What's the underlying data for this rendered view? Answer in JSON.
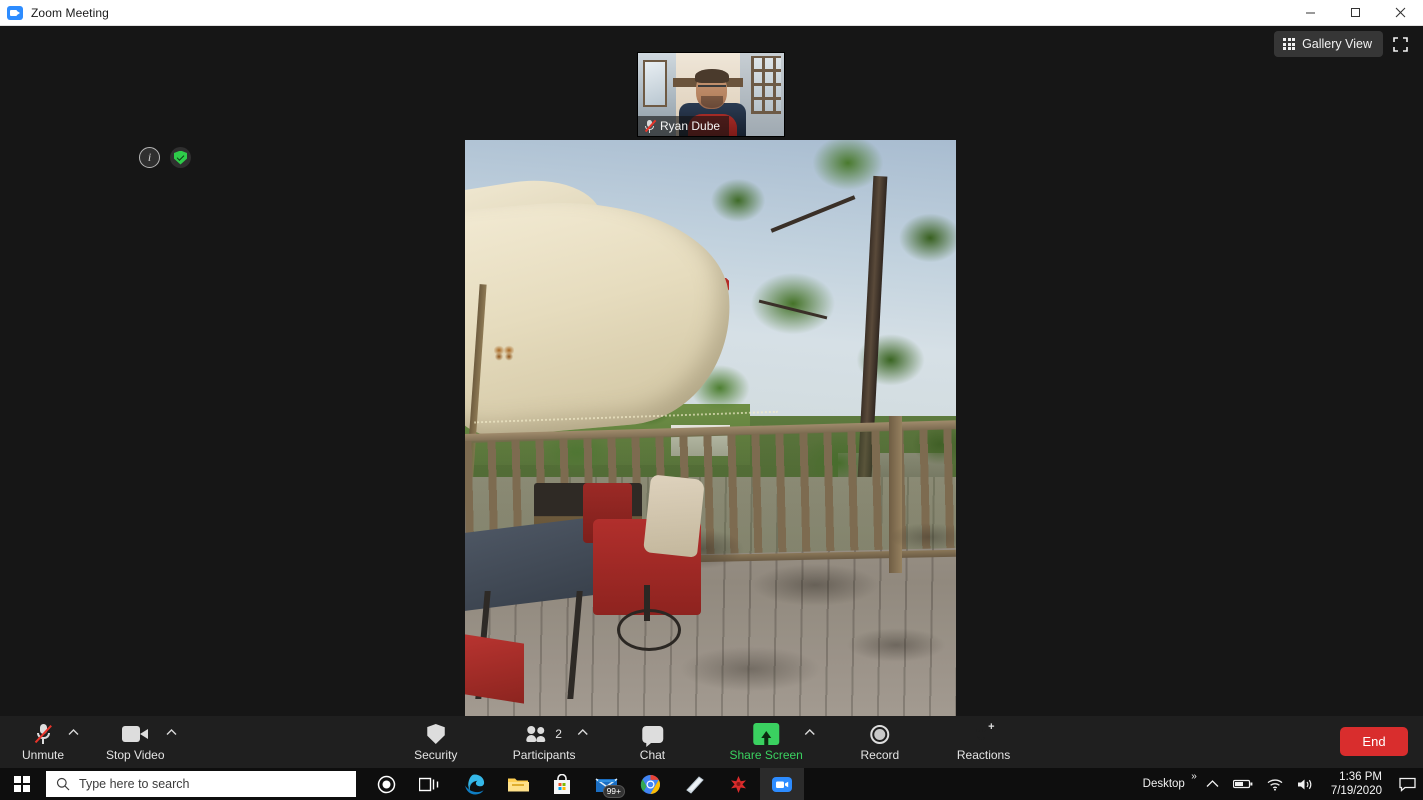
{
  "window": {
    "title": "Zoom Meeting",
    "app_icon": "zoom-icon",
    "minimize_label": "Minimize",
    "maximize_label": "Maximize",
    "close_label": "Close"
  },
  "stage": {
    "view_button": {
      "label": "Gallery View",
      "icon": "grid-icon"
    },
    "fullscreen_icon": "fullscreen-icon",
    "overlay_icons": [
      {
        "name": "meeting-info-icon",
        "glyph": "i"
      },
      {
        "name": "encryption-shield-icon",
        "glyph": "check"
      }
    ],
    "thumbnail": {
      "participant_name": "Ryan Dube",
      "mic_state": "muted",
      "mic_icon": "mic-muted-icon"
    },
    "active_speaker": {
      "participant_name": "Ryan Dube",
      "signal_icon": "signal-bars-icon"
    }
  },
  "toolbar": {
    "audio": {
      "label": "Unmute",
      "icon": "mic-muted-icon",
      "has_caret": true
    },
    "video": {
      "label": "Stop Video",
      "icon": "camera-icon",
      "has_caret": true
    },
    "security": {
      "label": "Security",
      "icon": "shield-icon",
      "has_caret": false
    },
    "participants": {
      "label": "Participants",
      "icon": "people-icon",
      "count": "2",
      "has_caret": true
    },
    "chat": {
      "label": "Chat",
      "icon": "chat-bubble-icon",
      "has_caret": false
    },
    "share": {
      "label": "Share Screen",
      "icon": "share-arrow-icon",
      "has_caret": true,
      "accent": "#3ad160"
    },
    "record": {
      "label": "Record",
      "icon": "record-circle-icon",
      "has_caret": false
    },
    "reactions": {
      "label": "Reactions",
      "icon": "smiley-plus-icon",
      "has_caret": false
    },
    "end": {
      "label": "End",
      "color": "#d92d2d"
    }
  },
  "taskbar": {
    "start_label": "Start",
    "search_placeholder": "Type here to search",
    "apps": [
      {
        "name": "cortana-icon",
        "label": "Cortana"
      },
      {
        "name": "task-view-icon",
        "label": "Task View"
      },
      {
        "name": "edge-icon",
        "label": "Microsoft Edge"
      },
      {
        "name": "file-explorer-icon",
        "label": "File Explorer"
      },
      {
        "name": "microsoft-store-icon",
        "label": "Microsoft Store"
      },
      {
        "name": "mail-icon",
        "label": "Mail",
        "badge": "99+"
      },
      {
        "name": "chrome-icon",
        "label": "Google Chrome"
      },
      {
        "name": "sticky-notes-icon",
        "label": "Notes"
      },
      {
        "name": "red-app-icon",
        "label": "App"
      },
      {
        "name": "zoom-taskbar-icon",
        "label": "Zoom",
        "active": true
      }
    ],
    "tray": {
      "desktop_label": "Desktop",
      "overflow_glyph": "»",
      "show_hidden_icon": "chevron-up-icon",
      "battery_icon": "battery-icon",
      "network_icon": "wifi-icon",
      "volume_icon": "speaker-icon",
      "time": "1:36 PM",
      "date": "7/19/2020",
      "action_center_icon": "notification-icon"
    }
  }
}
